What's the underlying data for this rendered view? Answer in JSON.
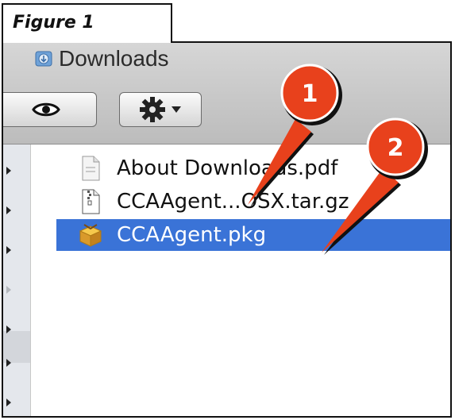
{
  "caption": "Figure 1",
  "window": {
    "title": "Downloads",
    "folder_icon": "downloads-folder-icon"
  },
  "toolbar": {
    "quicklook_icon": "eye-icon",
    "action_icon": "gear-icon",
    "action_menu_icon": "chevron-down-icon"
  },
  "files": [
    {
      "name": "About Downloads.pdf",
      "icon": "pdf-document-icon",
      "selected": false
    },
    {
      "name": "CCAAgent...OSX.tar.gz",
      "icon": "archive-icon",
      "selected": false
    },
    {
      "name": "CCAAgent.pkg",
      "icon": "package-icon",
      "selected": true
    }
  ],
  "annotations": [
    {
      "label": "1"
    },
    {
      "label": "2"
    }
  ],
  "colors": {
    "selection": "#3a73d7",
    "annotation_red": "#e8411c",
    "toolbar_bg": "#c8c8c8"
  }
}
